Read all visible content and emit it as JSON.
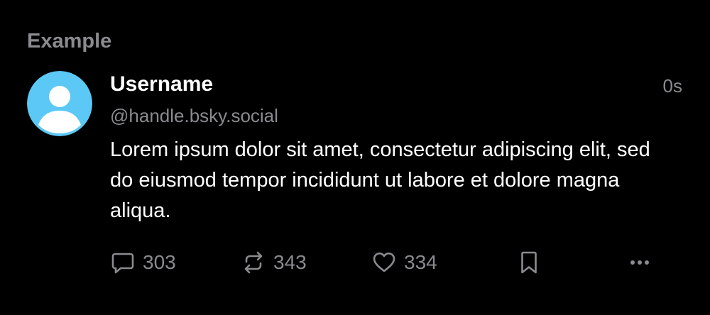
{
  "section": {
    "title": "Example"
  },
  "post": {
    "avatar_color": "#5bc8f5",
    "username": "Username",
    "handle": "@handle.bsky.social",
    "timestamp": "0s",
    "text": "Lorem ipsum dolor sit amet, consectetur adipiscing elit, sed do eiusmod tempor incididunt ut labore et dolore magna aliqua.",
    "actions": {
      "reply": {
        "icon": "reply-icon",
        "count": "303"
      },
      "repost": {
        "icon": "repost-icon",
        "count": "343"
      },
      "like": {
        "icon": "heart-icon",
        "count": "334"
      },
      "bookmark": {
        "icon": "bookmark-icon"
      },
      "more": {
        "icon": "more-icon"
      }
    }
  },
  "colors": {
    "background": "#000000",
    "primary_text": "#ffffff",
    "secondary_text": "#8a8a8f",
    "avatar": "#5bc8f5"
  }
}
